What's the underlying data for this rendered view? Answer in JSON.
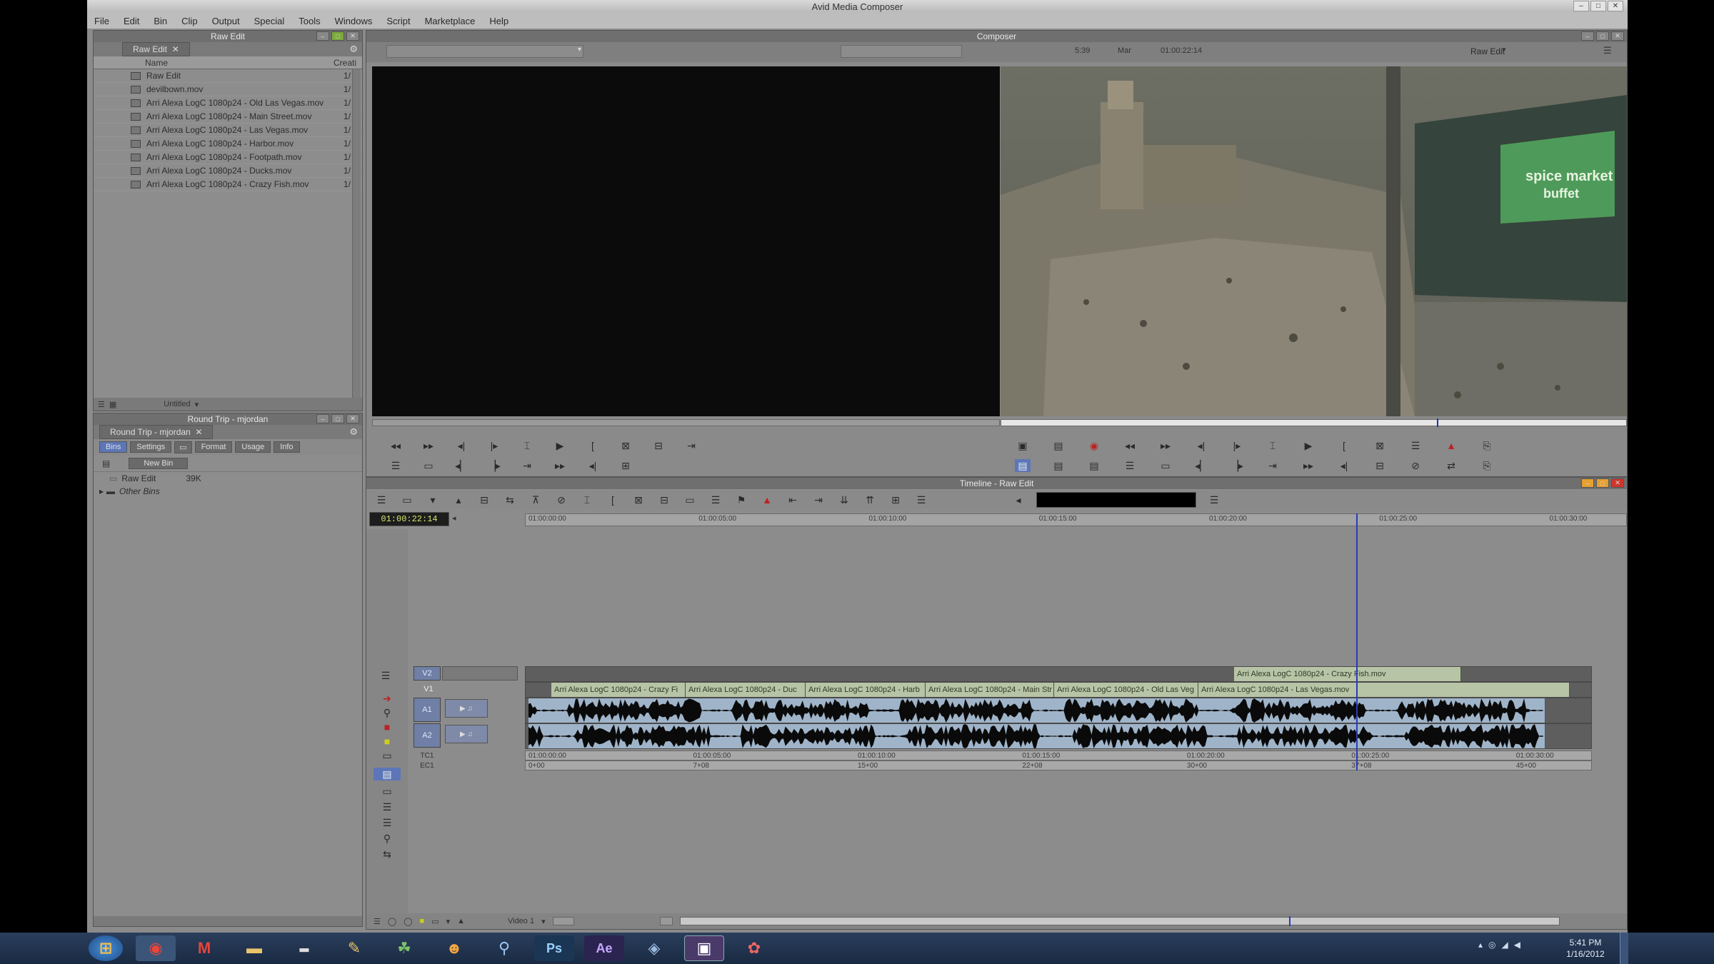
{
  "app": {
    "title": "Avid Media Composer"
  },
  "menu": [
    "File",
    "Edit",
    "Bin",
    "Clip",
    "Output",
    "Special",
    "Tools",
    "Windows",
    "Script",
    "Marketplace",
    "Help"
  ],
  "bin_panel": {
    "title": "Raw Edit",
    "tab": "Raw Edit",
    "col_name": "Name",
    "col_creat": "Creati",
    "items": [
      {
        "name": "Raw Edit",
        "n": "1/"
      },
      {
        "name": "devilbown.mov",
        "n": "1/"
      },
      {
        "name": "Arri Alexa LogC 1080p24 - Old Las Vegas.mov",
        "n": "1/"
      },
      {
        "name": "Arri Alexa LogC 1080p24 - Main Street.mov",
        "n": "1/"
      },
      {
        "name": "Arri Alexa LogC 1080p24 - Las Vegas.mov",
        "n": "1/"
      },
      {
        "name": "Arri Alexa LogC 1080p24 - Harbor.mov",
        "n": "1/"
      },
      {
        "name": "Arri Alexa LogC 1080p24 - Footpath.mov",
        "n": "1/"
      },
      {
        "name": "Arri Alexa LogC 1080p24 - Ducks.mov",
        "n": "1/"
      },
      {
        "name": "Arri Alexa LogC 1080p24 - Crazy Fish.mov",
        "n": "1/"
      }
    ],
    "footer_view": "Untitled"
  },
  "project_panel": {
    "title": "Round Trip - mjordan",
    "tab": "Round Trip - mjordan",
    "subtabs": [
      "Bins",
      "Settings",
      "Format",
      "Usage",
      "Info"
    ],
    "new_bin": "New Bin",
    "items": [
      {
        "name": "Raw Edit",
        "size": "39K"
      },
      {
        "name": "Other Bins",
        "size": ""
      }
    ]
  },
  "composer": {
    "title": "Composer",
    "label_a": "5:39",
    "label_b": "Mar",
    "label_c": "01:00:22:14",
    "seq_name": "Raw Edit"
  },
  "timeline": {
    "title": "Timeline - Raw Edit",
    "timecode": "01:00:22:14",
    "ruler": [
      "01:00:00:00",
      "01:00:05:00",
      "01:00:10:00",
      "01:00:15:00",
      "01:00:20:00",
      "01:00:25:00",
      "01:00:30:00"
    ],
    "tracks": [
      "V2",
      "V1",
      "A1",
      "A2",
      "TC1",
      "EC1"
    ],
    "v2_clip": "Arri Alexa LogC 1080p24 - Crazy Fish.mov",
    "v1_clips": [
      "Arri Alexa LogC 1080p24 - Crazy Fi",
      "Arri Alexa LogC 1080p24 - Duc",
      "Arri Alexa LogC 1080p24 - Harb",
      "Arri Alexa LogC 1080p24 - Main Str",
      "Arri Alexa LogC 1080p24 - Old Las Veg",
      "Arri Alexa LogC 1080p24 - Las Vegas.mov"
    ],
    "tc_ruler": [
      "01:00:00:00",
      "01:00:05:00",
      "01:00:10:00",
      "01:00:15:00",
      "01:00:20:00",
      "01:00:25:00",
      "01:00:30:00"
    ],
    "ec_ruler": [
      "0+00",
      "7+08",
      "15+00",
      "22+08",
      "30+00",
      "37+08",
      "45+00"
    ],
    "footer_video": "Video 1"
  },
  "taskbar": {
    "time": "5:41 PM",
    "date": "1/16/2012",
    "apps": [
      "start",
      "chrome",
      "gmail",
      "explorer",
      "terminal",
      "tool",
      "people",
      "fox",
      "network",
      "photoshop",
      "after-effects",
      "vpn",
      "avid",
      "resolve"
    ]
  }
}
